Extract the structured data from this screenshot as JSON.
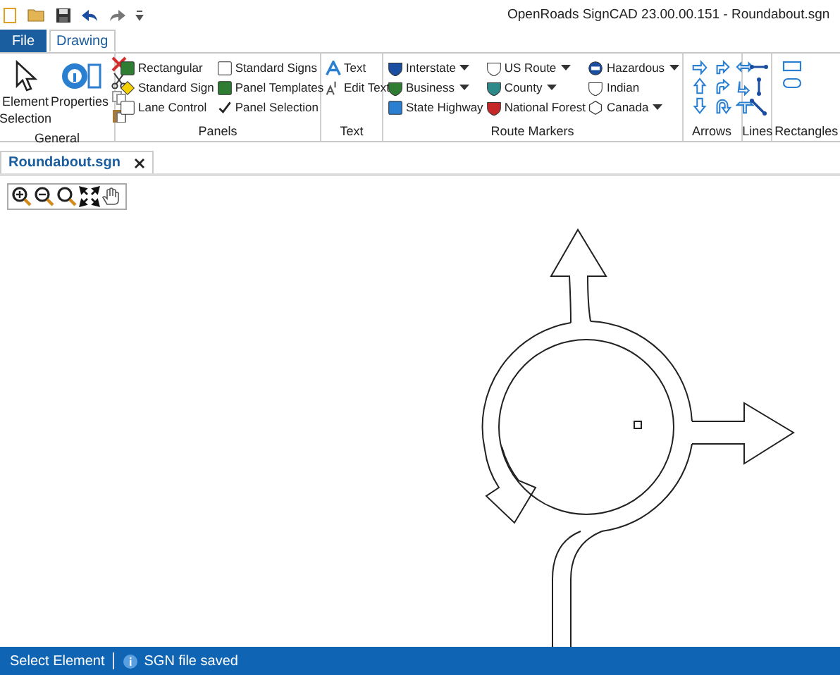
{
  "window": {
    "title": "OpenRoads SignCAD 23.00.00.151 - Roundabout.sgn"
  },
  "tabs": [
    {
      "label": "File",
      "kind": "menu",
      "selected": false
    },
    {
      "label": "Drawing",
      "kind": "tab",
      "selected": true
    }
  ],
  "ribbon": [
    {
      "label": "General",
      "items": [
        {
          "label": "Element Selection",
          "kind": "large"
        },
        {
          "label": "Properties",
          "kind": "large"
        }
      ]
    },
    {
      "label": "Panels",
      "items": [
        {
          "label": "Rectangular",
          "kind": "small"
        },
        {
          "label": "Standard Sign",
          "kind": "small"
        },
        {
          "label": "Lane Control",
          "kind": "small"
        },
        {
          "label": "Standard Signs",
          "kind": "small"
        },
        {
          "label": "Panel Templates",
          "kind": "small"
        },
        {
          "label": "Panel Selection",
          "kind": "small"
        }
      ]
    },
    {
      "label": "Text",
      "items": [
        {
          "label": "Text",
          "kind": "small"
        },
        {
          "label": "Edit Text",
          "kind": "small"
        }
      ]
    },
    {
      "label": "Route Markers",
      "items": [
        {
          "label": "Interstate",
          "kind": "small",
          "dropdown": true
        },
        {
          "label": "Business",
          "kind": "small",
          "dropdown": true
        },
        {
          "label": "State Highway",
          "kind": "small",
          "dropdown": false
        },
        {
          "label": "US Route",
          "kind": "small",
          "dropdown": true
        },
        {
          "label": "County",
          "kind": "small",
          "dropdown": true
        },
        {
          "label": "National Forest",
          "kind": "small",
          "dropdown": false
        },
        {
          "label": "Hazardous",
          "kind": "small",
          "dropdown": true
        },
        {
          "label": "Indian",
          "kind": "small",
          "dropdown": false
        },
        {
          "label": "Canada",
          "kind": "small",
          "dropdown": true
        }
      ]
    },
    {
      "label": "Arrows"
    },
    {
      "label": "Lines"
    },
    {
      "label": "Rectangles"
    }
  ],
  "documents": [
    {
      "label": "Roundabout.sgn",
      "selected": true
    }
  ],
  "status_bar": [
    "Select Element",
    "SGN file saved"
  ]
}
